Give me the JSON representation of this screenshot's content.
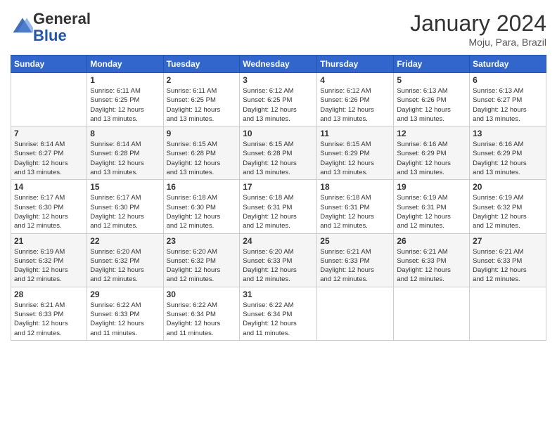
{
  "logo": {
    "general": "General",
    "blue": "Blue"
  },
  "title": "January 2024",
  "location": "Moju, Para, Brazil",
  "days_header": [
    "Sunday",
    "Monday",
    "Tuesday",
    "Wednesday",
    "Thursday",
    "Friday",
    "Saturday"
  ],
  "weeks": [
    [
      {
        "day": "",
        "info": ""
      },
      {
        "day": "1",
        "info": "Sunrise: 6:11 AM\nSunset: 6:25 PM\nDaylight: 12 hours\nand 13 minutes."
      },
      {
        "day": "2",
        "info": "Sunrise: 6:11 AM\nSunset: 6:25 PM\nDaylight: 12 hours\nand 13 minutes."
      },
      {
        "day": "3",
        "info": "Sunrise: 6:12 AM\nSunset: 6:25 PM\nDaylight: 12 hours\nand 13 minutes."
      },
      {
        "day": "4",
        "info": "Sunrise: 6:12 AM\nSunset: 6:26 PM\nDaylight: 12 hours\nand 13 minutes."
      },
      {
        "day": "5",
        "info": "Sunrise: 6:13 AM\nSunset: 6:26 PM\nDaylight: 12 hours\nand 13 minutes."
      },
      {
        "day": "6",
        "info": "Sunrise: 6:13 AM\nSunset: 6:27 PM\nDaylight: 12 hours\nand 13 minutes."
      }
    ],
    [
      {
        "day": "7",
        "info": "Sunrise: 6:14 AM\nSunset: 6:27 PM\nDaylight: 12 hours\nand 13 minutes."
      },
      {
        "day": "8",
        "info": "Sunrise: 6:14 AM\nSunset: 6:28 PM\nDaylight: 12 hours\nand 13 minutes."
      },
      {
        "day": "9",
        "info": "Sunrise: 6:15 AM\nSunset: 6:28 PM\nDaylight: 12 hours\nand 13 minutes."
      },
      {
        "day": "10",
        "info": "Sunrise: 6:15 AM\nSunset: 6:28 PM\nDaylight: 12 hours\nand 13 minutes."
      },
      {
        "day": "11",
        "info": "Sunrise: 6:15 AM\nSunset: 6:29 PM\nDaylight: 12 hours\nand 13 minutes."
      },
      {
        "day": "12",
        "info": "Sunrise: 6:16 AM\nSunset: 6:29 PM\nDaylight: 12 hours\nand 13 minutes."
      },
      {
        "day": "13",
        "info": "Sunrise: 6:16 AM\nSunset: 6:29 PM\nDaylight: 12 hours\nand 13 minutes."
      }
    ],
    [
      {
        "day": "14",
        "info": "Sunrise: 6:17 AM\nSunset: 6:30 PM\nDaylight: 12 hours\nand 12 minutes."
      },
      {
        "day": "15",
        "info": "Sunrise: 6:17 AM\nSunset: 6:30 PM\nDaylight: 12 hours\nand 12 minutes."
      },
      {
        "day": "16",
        "info": "Sunrise: 6:18 AM\nSunset: 6:30 PM\nDaylight: 12 hours\nand 12 minutes."
      },
      {
        "day": "17",
        "info": "Sunrise: 6:18 AM\nSunset: 6:31 PM\nDaylight: 12 hours\nand 12 minutes."
      },
      {
        "day": "18",
        "info": "Sunrise: 6:18 AM\nSunset: 6:31 PM\nDaylight: 12 hours\nand 12 minutes."
      },
      {
        "day": "19",
        "info": "Sunrise: 6:19 AM\nSunset: 6:31 PM\nDaylight: 12 hours\nand 12 minutes."
      },
      {
        "day": "20",
        "info": "Sunrise: 6:19 AM\nSunset: 6:32 PM\nDaylight: 12 hours\nand 12 minutes."
      }
    ],
    [
      {
        "day": "21",
        "info": "Sunrise: 6:19 AM\nSunset: 6:32 PM\nDaylight: 12 hours\nand 12 minutes."
      },
      {
        "day": "22",
        "info": "Sunrise: 6:20 AM\nSunset: 6:32 PM\nDaylight: 12 hours\nand 12 minutes."
      },
      {
        "day": "23",
        "info": "Sunrise: 6:20 AM\nSunset: 6:32 PM\nDaylight: 12 hours\nand 12 minutes."
      },
      {
        "day": "24",
        "info": "Sunrise: 6:20 AM\nSunset: 6:33 PM\nDaylight: 12 hours\nand 12 minutes."
      },
      {
        "day": "25",
        "info": "Sunrise: 6:21 AM\nSunset: 6:33 PM\nDaylight: 12 hours\nand 12 minutes."
      },
      {
        "day": "26",
        "info": "Sunrise: 6:21 AM\nSunset: 6:33 PM\nDaylight: 12 hours\nand 12 minutes."
      },
      {
        "day": "27",
        "info": "Sunrise: 6:21 AM\nSunset: 6:33 PM\nDaylight: 12 hours\nand 12 minutes."
      }
    ],
    [
      {
        "day": "28",
        "info": "Sunrise: 6:21 AM\nSunset: 6:33 PM\nDaylight: 12 hours\nand 12 minutes."
      },
      {
        "day": "29",
        "info": "Sunrise: 6:22 AM\nSunset: 6:33 PM\nDaylight: 12 hours\nand 11 minutes."
      },
      {
        "day": "30",
        "info": "Sunrise: 6:22 AM\nSunset: 6:34 PM\nDaylight: 12 hours\nand 11 minutes."
      },
      {
        "day": "31",
        "info": "Sunrise: 6:22 AM\nSunset: 6:34 PM\nDaylight: 12 hours\nand 11 minutes."
      },
      {
        "day": "",
        "info": ""
      },
      {
        "day": "",
        "info": ""
      },
      {
        "day": "",
        "info": ""
      }
    ]
  ]
}
